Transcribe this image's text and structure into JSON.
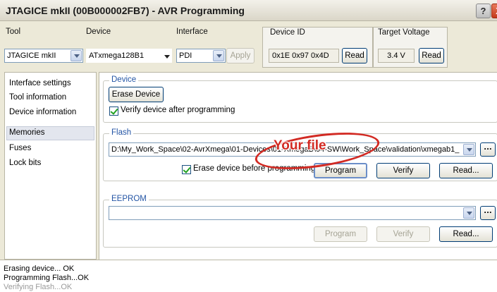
{
  "window": {
    "title": "JTAGICE mkII (00B000002FB7) - AVR Programming",
    "help_label": "?",
    "close_label": "X"
  },
  "header": {
    "tool_label": "Tool",
    "tool_value": "JTAGICE mkII",
    "device_label": "Device",
    "device_value": "ATxmega128B1",
    "interface_label": "Interface",
    "interface_value": "PDI",
    "apply_label": "Apply",
    "device_id_label": "Device ID",
    "device_id_value": "0x1E 0x97 0x4D",
    "read_id_label": "Read",
    "target_voltage_label": "Target Voltage",
    "target_voltage_value": "3.4 V",
    "read_voltage_label": "Read"
  },
  "nav": {
    "items": [
      {
        "label": "Interface settings"
      },
      {
        "label": "Tool information"
      },
      {
        "label": "Device information"
      },
      {
        "label": "Memories"
      },
      {
        "label": "Fuses"
      },
      {
        "label": "Lock bits"
      }
    ],
    "selected": "Memories"
  },
  "device_group": {
    "title": "Device",
    "erase_label": "Erase Device",
    "verify_label": "Verify device after programming",
    "verify_checked": true
  },
  "flash_group": {
    "title": "Flash",
    "path": "D:\\My_Work_Space\\02-AvrXmega\\01-Devices\\01-XmegaB\\04-SW\\Work_Space\\validation\\xmegab1_",
    "browse_label": "...",
    "erase_before_label": "Erase device before programming",
    "erase_before_checked": true,
    "program_label": "Program",
    "verify_label": "Verify",
    "read_label": "Read...",
    "annotation": "Your file",
    "annotation_color": "#d22a23"
  },
  "eeprom_group": {
    "title": "EEPROM",
    "path": "",
    "browse_label": "...",
    "program_label": "Program",
    "verify_label": "Verify",
    "read_label": "Read..."
  },
  "status": {
    "lines": [
      "Erasing device... OK",
      "Programming Flash...OK",
      "Verifying Flash...OK"
    ]
  }
}
